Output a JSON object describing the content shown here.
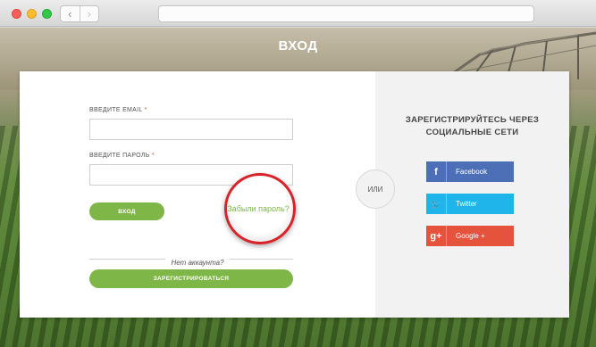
{
  "page": {
    "heading": "ВХОД"
  },
  "login": {
    "email_label": "ВВЕДИТЕ EMAIL",
    "password_label": "ВВЕДИТЕ ПАРОЛЬ",
    "required_mark": "*",
    "login_button": "ВХОД",
    "forgot_link": "Забыли пароль?",
    "no_account": "Нет аккаунта?",
    "register_button": "ЗАРЕГИСТРИРОВАТЬСЯ"
  },
  "divider": {
    "or_label": "ИЛИ"
  },
  "social": {
    "title_line1": "ЗАРЕГИСТРИРУЙТЕСЬ ЧЕРЕЗ",
    "title_line2": "СОЦИАЛЬНЫЕ СЕТИ",
    "buttons": [
      {
        "label": "Facebook",
        "icon": "facebook-icon",
        "icon_glyph": "f",
        "color": "#4d6fb8"
      },
      {
        "label": "Twitter",
        "icon": "twitter-icon",
        "icon_glyph": "🐦",
        "color": "#1fb5ea"
      },
      {
        "label": "Google +",
        "icon": "google-plus-icon",
        "icon_glyph": "g+",
        "color": "#e5533d"
      }
    ]
  },
  "colors": {
    "accent": "#7fb648",
    "highlight_ring": "#d8232a"
  },
  "icons": {
    "back": "chevron-left-icon",
    "back_glyph": "‹",
    "forward": "chevron-right-icon",
    "forward_glyph": "›"
  }
}
